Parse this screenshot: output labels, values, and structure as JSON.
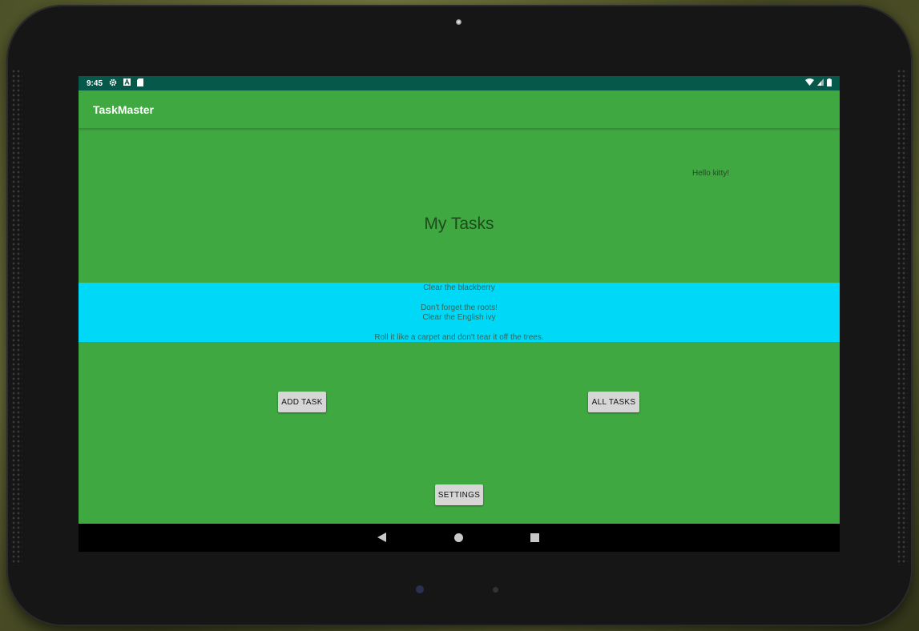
{
  "status_bar": {
    "time": "9:45",
    "left_icons": [
      "gear-icon",
      "a-notification-icon",
      "sd-card-icon"
    ],
    "right_icons": [
      "wifi-icon",
      "signal-icon",
      "battery-icon"
    ]
  },
  "app_bar": {
    "title": "TaskMaster"
  },
  "main": {
    "greeting": "Hello kitty!",
    "heading": "My Tasks",
    "tasks": [
      {
        "title": "Clear the blackberry",
        "body": "Don't forget the roots!"
      },
      {
        "title": "Clear the English ivy",
        "body": "Roll it like a carpet and don't tear it off the trees."
      }
    ],
    "buttons": {
      "add_task": "ADD TASK",
      "all_tasks": "ALL TASKS",
      "settings": "SETTINGS"
    }
  },
  "nav_bar": {
    "icons": [
      "back-icon",
      "home-icon",
      "recents-icon"
    ]
  },
  "colors": {
    "status_bar": "#05584a",
    "app_background": "#40a840",
    "task_list_background": "#00d8f8",
    "button_background": "#d6d6d6"
  }
}
